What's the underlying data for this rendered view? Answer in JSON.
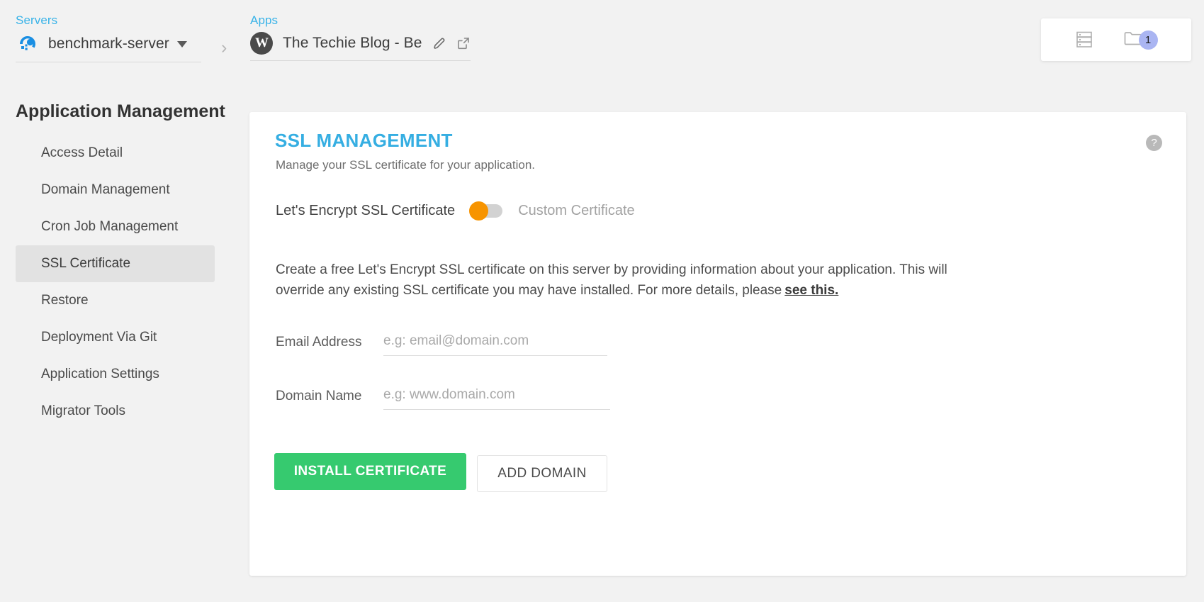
{
  "breadcrumb": {
    "servers": {
      "label": "Servers",
      "name": "benchmark-server",
      "icon": "cloudways-logo-icon",
      "dropdown_icon": "chevron-down-icon"
    },
    "separator": "›",
    "apps": {
      "label": "Apps",
      "name": "The Techie Blog - Be",
      "icon": "wordpress-logo-icon",
      "edit_icon": "pencil-icon",
      "launch_icon": "external-link-icon"
    }
  },
  "topright": {
    "server_list_icon": "server-stack-icon",
    "folder_icon": "folder-icon",
    "badge": "1"
  },
  "sidebar": {
    "title": "Application Management",
    "items": [
      {
        "label": "Access Detail",
        "active": false
      },
      {
        "label": "Domain Management",
        "active": false
      },
      {
        "label": "Cron Job Management",
        "active": false
      },
      {
        "label": "SSL Certificate",
        "active": true
      },
      {
        "label": "Restore",
        "active": false
      },
      {
        "label": "Deployment Via Git",
        "active": false
      },
      {
        "label": "Application Settings",
        "active": false
      },
      {
        "label": "Migrator Tools",
        "active": false
      }
    ]
  },
  "card": {
    "title": "SSL MANAGEMENT",
    "subtitle": "Manage your SSL certificate for your application.",
    "help_icon": "?",
    "toggle": {
      "left_label": "Let's Encrypt SSL Certificate",
      "right_label": "Custom Certificate",
      "state": "left",
      "knob_color": "#f79400",
      "track_color": "#d2d2d2"
    },
    "description": "Create a free Let's Encrypt SSL certificate on this server by providing information about your application. This will override any existing SSL certificate you may have installed. For more details, please",
    "description_link": "see this.",
    "fields": [
      {
        "label": "Email Address",
        "value": "",
        "placeholder": "e.g: email@domain.com"
      },
      {
        "label": "Domain Name",
        "value": "",
        "placeholder": "e.g: www.domain.com"
      }
    ],
    "buttons": {
      "primary": "INSTALL CERTIFICATE",
      "secondary": "ADD DOMAIN"
    }
  },
  "colors": {
    "accent_blue": "#35aee2",
    "primary_green": "#36ca6f",
    "toggle_orange": "#f79400",
    "badge_purple": "#aab5f2",
    "page_bg": "#f2f2f2"
  }
}
